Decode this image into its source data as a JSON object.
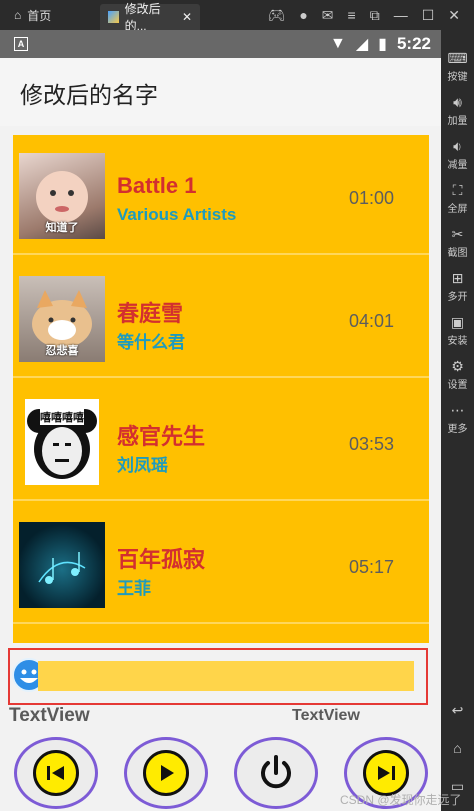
{
  "emulator": {
    "home_label": "首页",
    "tab_label": "修改后的...",
    "sidebar": [
      {
        "label": "按键",
        "icon": "keyboard-icon"
      },
      {
        "label": "加量",
        "icon": "volume-up-icon"
      },
      {
        "label": "减量",
        "icon": "volume-down-icon"
      },
      {
        "label": "全屏",
        "icon": "fullscreen-icon"
      },
      {
        "label": "截图",
        "icon": "scissors-icon"
      },
      {
        "label": "多开",
        "icon": "multi-instance-icon"
      },
      {
        "label": "安装",
        "icon": "apk-icon"
      },
      {
        "label": "设置",
        "icon": "gear-icon"
      },
      {
        "label": "更多",
        "icon": "more-icon"
      }
    ]
  },
  "status_bar": {
    "time": "5:22"
  },
  "app": {
    "title": "修改后的名字"
  },
  "songs": [
    {
      "title": "Battle 1",
      "artist": "Various Artists",
      "duration": "01:00",
      "cover_caption": "知道了"
    },
    {
      "title": "春庭雪",
      "artist": "等什么君",
      "duration": "04:01",
      "cover_caption": "忍悲喜"
    },
    {
      "title": "感官先生",
      "artist": "刘凤瑶",
      "duration": "03:53",
      "cover_caption": "嘻嘻嘻嘻"
    },
    {
      "title": "百年孤寂",
      "artist": "王菲",
      "duration": "05:17",
      "cover_caption": ""
    }
  ],
  "player": {
    "text_left": "TextView",
    "text_right": "TextView",
    "progress": 0,
    "colors": {
      "accent": "#ffc000",
      "title": "#d32f2f",
      "artist": "#1e9bbd",
      "ring": "#7d5bd6"
    }
  },
  "controls": [
    {
      "name": "previous",
      "icon": "previous-track-icon"
    },
    {
      "name": "play",
      "icon": "play-icon"
    },
    {
      "name": "stop",
      "icon": "power-icon"
    },
    {
      "name": "next",
      "icon": "next-track-icon"
    }
  ],
  "watermark": "CSDN @发现你走远了"
}
